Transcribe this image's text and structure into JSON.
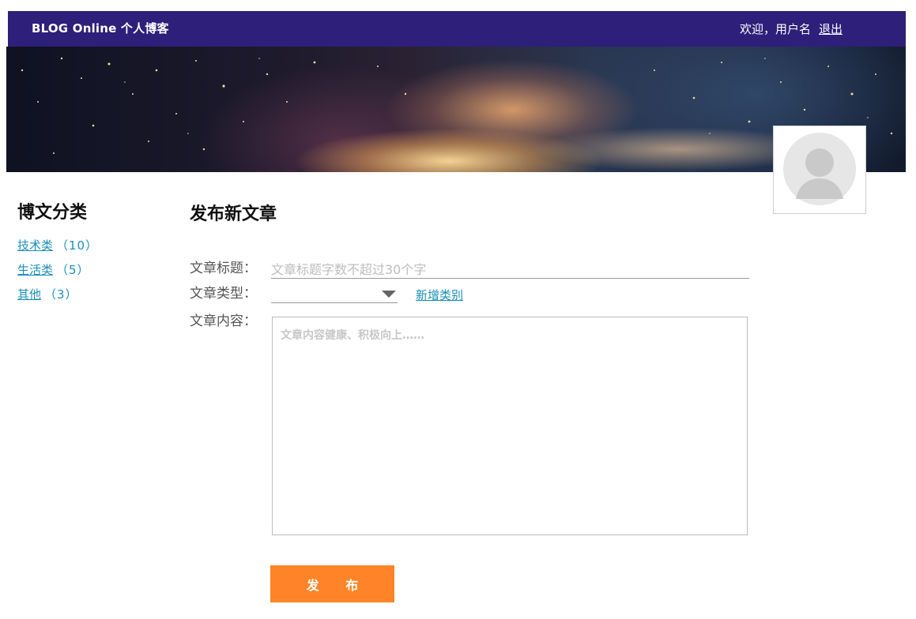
{
  "header": {
    "brand": "BLOG Online 个人博客",
    "welcome": "欢迎，用户名",
    "logout_label": "退出"
  },
  "sidebar": {
    "title": "博文分类",
    "categories": [
      {
        "label": "技术类",
        "count": "（10）"
      },
      {
        "label": "生活类",
        "count": "（5）"
      },
      {
        "label": "其他",
        "count": "（3）"
      }
    ]
  },
  "form": {
    "heading": "发布新文章",
    "title_label": "文章标题：",
    "title_value": "",
    "title_placeholder": "文章标题字数不超过30个字",
    "type_label": "文章类型：",
    "type_selected": "",
    "add_category_label": "新增类别",
    "content_label": "文章内容：",
    "content_value": "",
    "content_placeholder": "文章内容健康、积极向上……",
    "submit_label": "发 布"
  },
  "colors": {
    "navbar": "#2e1f7a",
    "link": "#1a8fb8",
    "button": "#ff8427"
  }
}
